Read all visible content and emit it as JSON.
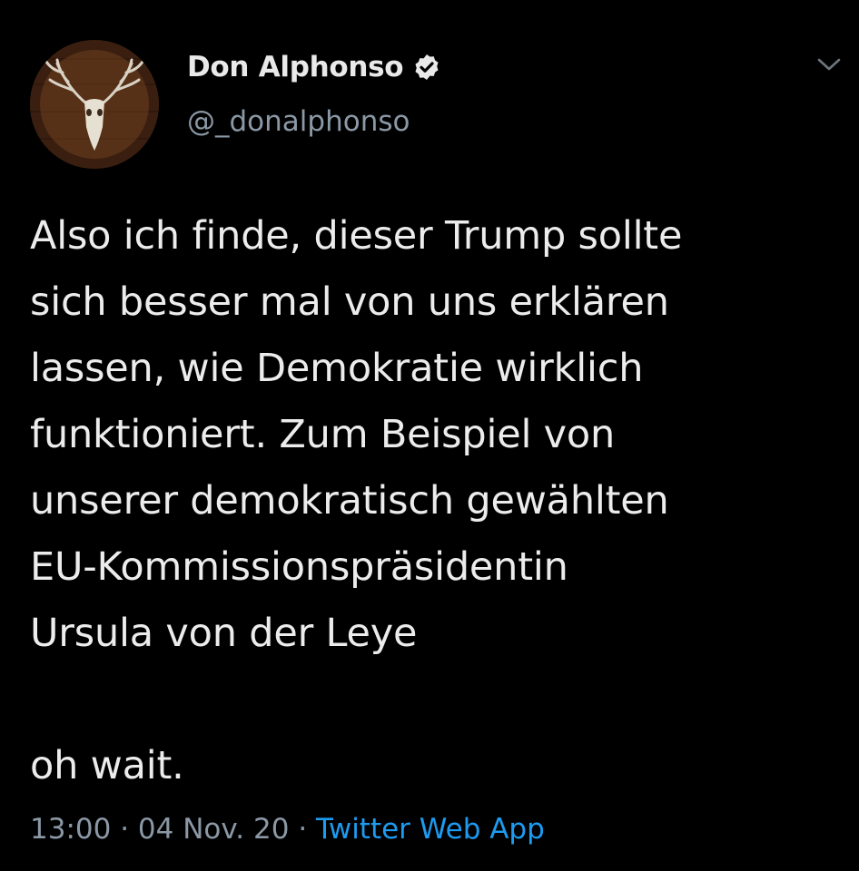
{
  "author": {
    "display_name": "Don Alphonso",
    "handle": "@_donalphonso",
    "verified": true,
    "avatar_icon": "deer-skull-antlers-icon"
  },
  "tweet": {
    "lines": [
      "Also ich finde, dieser Trump sollte",
      "sich besser mal von uns erklären",
      "lassen, wie Demokratie wirklich",
      "funktioniert. Zum Beispiel von",
      "unserer demokratisch gewählten",
      "EU-Kommissionspräsidentin",
      "Ursula von der Leye",
      "",
      "oh wait."
    ]
  },
  "meta": {
    "time": "13:00",
    "separator": " · ",
    "date": "04 Nov. 20",
    "source": "Twitter Web App"
  },
  "colors": {
    "background": "#000000",
    "text": "#ececec",
    "secondary": "#8b98a5",
    "link": "#1d9bf0"
  }
}
